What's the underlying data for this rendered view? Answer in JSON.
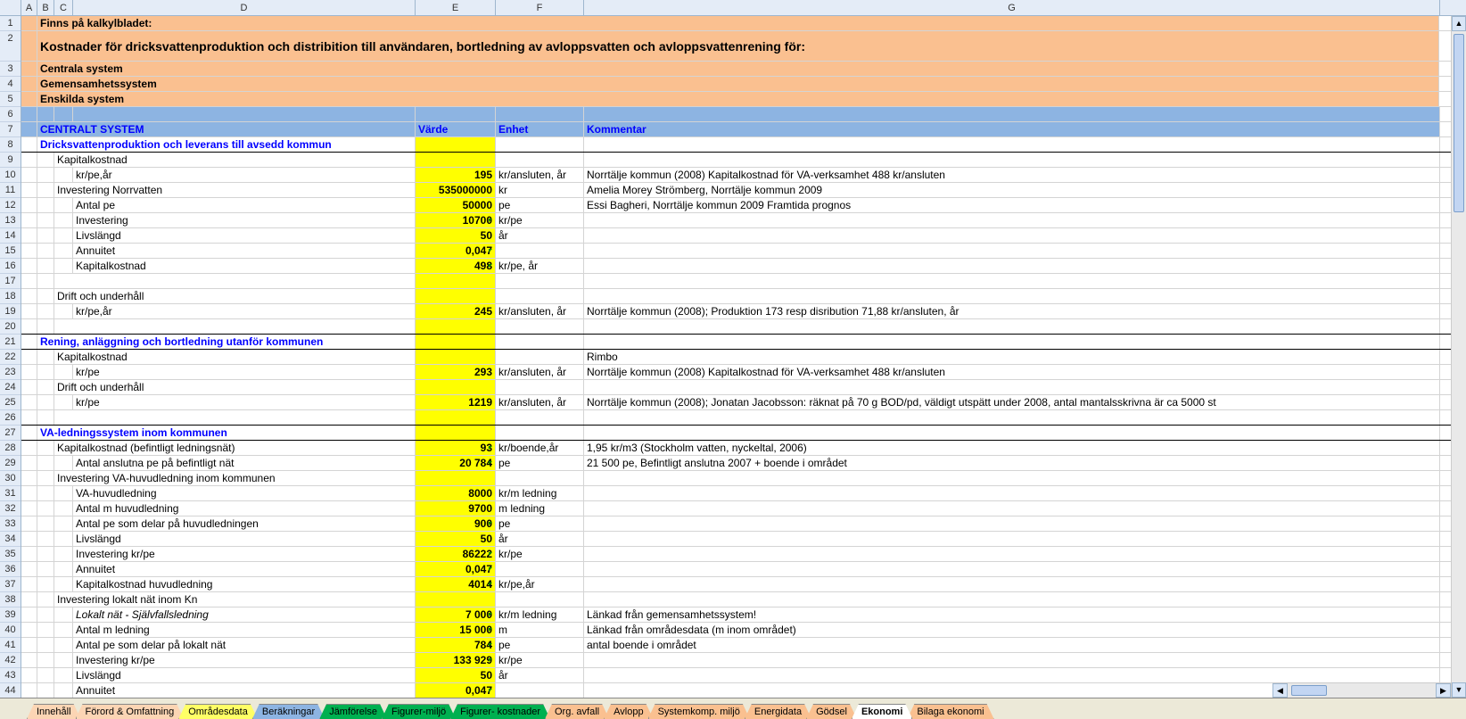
{
  "columns": [
    "A",
    "B",
    "C",
    "D",
    "E",
    "F",
    "G"
  ],
  "section_headers": {
    "varde": "Värde",
    "enhet": "Enhet",
    "kommentar": "Kommentar"
  },
  "orange": {
    "r1": "Finns på kalkylbladet:",
    "r2": "Kostnader för dricksvattenproduktion och distribition till användaren, bortledning av avloppsvatten och avloppsvattenrening för:",
    "r3": "Centrala system",
    "r4": "Gemensamhetssystem",
    "r5": "Enskilda system"
  },
  "central_title": "CENTRALT SYSTEM",
  "sec8": "Dricksvattenproduktion och leverans till avsedd kommun",
  "rows": [
    {
      "n": 9,
      "d": "Kapitalkostnad",
      "e": "",
      "f": "",
      "g": "",
      "ind": 2
    },
    {
      "n": 10,
      "d": "kr/pe,år",
      "e": "195",
      "f": "kr/ansluten, år",
      "g": "Norrtälje kommun (2008) Kapitalkostnad för VA-verksamhet 488 kr/ansluten",
      "ind": 3
    },
    {
      "n": 11,
      "d": "Investering Norrvatten",
      "e": "535000000",
      "f": "kr",
      "g": "Amelia Morey Strömberg, Norrtälje kommun 2009",
      "ind": 2
    },
    {
      "n": 12,
      "d": "Antal pe",
      "e": "50000",
      "f": "pe",
      "g": "Essi Bagheri, Norrtälje kommun 2009 Framtida prognos",
      "ind": 3
    },
    {
      "n": 13,
      "d": "Investering",
      "e": "10700",
      "f": "kr/pe",
      "g": "",
      "ind": 3,
      "tri": true
    },
    {
      "n": 14,
      "d": "Livslängd",
      "e": "50",
      "f": "år",
      "g": "",
      "ind": 3
    },
    {
      "n": 15,
      "d": "Annuitet",
      "e": "0,047",
      "f": "",
      "g": "",
      "ind": 3,
      "tri": true
    },
    {
      "n": 16,
      "d": "Kapitalkostnad",
      "e": "498",
      "f": "kr/pe, år",
      "g": "",
      "ind": 3,
      "tri": true
    },
    {
      "n": 17,
      "d": "",
      "e": "",
      "f": "",
      "g": "",
      "ind": 0
    },
    {
      "n": 18,
      "d": "Drift och underhåll",
      "e": "",
      "f": "",
      "g": "",
      "ind": 2
    },
    {
      "n": 19,
      "d": "kr/pe,år",
      "e": "245",
      "f": "kr/ansluten, år",
      "g": "Norrtälje kommun (2008); Produktion 173 resp disribution 71,88 kr/ansluten, år",
      "ind": 3
    },
    {
      "n": 20,
      "d": "",
      "e": "",
      "f": "",
      "g": "",
      "ind": 0,
      "bb": true
    }
  ],
  "sec21": "Rening, anläggning och bortledning utanför kommunen",
  "rows2": [
    {
      "n": 22,
      "d": "Kapitalkostnad",
      "e": "",
      "f": "",
      "g": "Rimbo",
      "ind": 2
    },
    {
      "n": 23,
      "d": "kr/pe",
      "e": "293",
      "f": "kr/ansluten, år",
      "g": "Norrtälje kommun (2008) Kapitalkostnad för VA-verksamhet 488 kr/ansluten",
      "ind": 3
    },
    {
      "n": 24,
      "d": "Drift och underhåll",
      "e": "",
      "f": "",
      "g": "",
      "ind": 2
    },
    {
      "n": 25,
      "d": "kr/pe",
      "e": "1219",
      "f": "kr/ansluten, år",
      "g": "Norrtälje kommun (2008); Jonatan Jacobsson: räknat på 70 g BOD/pd, väldigt utspätt under 2008, antal mantalsskrivna är ca 5000 st",
      "ind": 3
    },
    {
      "n": 26,
      "d": "",
      "e": "",
      "f": "",
      "g": "",
      "ind": 0,
      "bb": true
    }
  ],
  "sec27": "VA-ledningssystem inom kommunen",
  "rows3": [
    {
      "n": 28,
      "d": "Kapitalkostnad (befintligt ledningsnät)",
      "e": "93",
      "f": "kr/boende,år",
      "g": "1,95 kr/m3 (Stockholm vatten, nyckeltal, 2006)",
      "ind": 2,
      "tri": true
    },
    {
      "n": 29,
      "d": "Antal anslutna pe på befintligt nät",
      "e": "20 784",
      "f": "pe",
      "g": "21 500 pe, Befintligt anslutna 2007 + boende i området",
      "ind": 3,
      "tri": true
    },
    {
      "n": 30,
      "d": "Investering VA-huvudledning inom kommunen",
      "e": "",
      "f": "",
      "g": "",
      "ind": 2
    },
    {
      "n": 31,
      "d": "VA-huvudledning",
      "e": "8000",
      "f": "kr/m ledning",
      "g": "",
      "ind": 3
    },
    {
      "n": 32,
      "d": "Antal m huvudledning",
      "e": "9700",
      "f": "m ledning",
      "g": "",
      "ind": 3
    },
    {
      "n": 33,
      "d": "Antal pe som delar på huvudledningen",
      "e": "900",
      "f": "pe",
      "g": "",
      "ind": 3,
      "tri": true
    },
    {
      "n": 34,
      "d": "Livslängd",
      "e": "50",
      "f": "år",
      "g": "",
      "ind": 3
    },
    {
      "n": 35,
      "d": "Investering kr/pe",
      "e": "86222",
      "f": "kr/pe",
      "g": "",
      "ind": 3,
      "tri": true
    },
    {
      "n": 36,
      "d": "Annuitet",
      "e": "0,047",
      "f": "",
      "g": "",
      "ind": 3,
      "tri": true
    },
    {
      "n": 37,
      "d": "Kapitalkostnad huvudledning",
      "e": "4014",
      "f": "kr/pe,år",
      "g": "",
      "ind": 3,
      "tri": true
    },
    {
      "n": 38,
      "d": "Investering lokalt nät inom Kn",
      "e": "",
      "f": "",
      "g": "",
      "ind": 2
    },
    {
      "n": 39,
      "d": "Lokalt nät - Självfallsledning",
      "e": "7 000",
      "f": "kr/m ledning",
      "g": "Länkad från gemensamhetssystem!",
      "ind": 3,
      "italic": true,
      "tri": true
    },
    {
      "n": 40,
      "d": "Antal m ledning",
      "e": "15 000",
      "f": "m",
      "g": "Länkad från områdesdata (m inom området)",
      "ind": 3,
      "tri": true
    },
    {
      "n": 41,
      "d": "Antal pe som delar på lokalt nät",
      "e": "784",
      "f": "pe",
      "g": "antal boende i området",
      "ind": 3,
      "tri": true
    },
    {
      "n": 42,
      "d": "Investering kr/pe",
      "e": "133 929",
      "f": "kr/pe",
      "g": "",
      "ind": 3,
      "tri": true
    },
    {
      "n": 43,
      "d": "Livslängd",
      "e": "50",
      "f": "år",
      "g": "",
      "ind": 3
    },
    {
      "n": 44,
      "d": "Annuitet",
      "e": "0,047",
      "f": "",
      "g": "",
      "ind": 3,
      "tri": true
    }
  ],
  "tabs": [
    {
      "label": "Innehåll",
      "color": "#fcd5b4"
    },
    {
      "label": "Förord & Omfattning",
      "color": "#fcd5b4"
    },
    {
      "label": "Områdesdata",
      "color": "#ffff66"
    },
    {
      "label": "Beräkningar",
      "color": "#8db4e2"
    },
    {
      "label": "Jämförelse",
      "color": "#00b050"
    },
    {
      "label": "Figurer-miljö",
      "color": "#00b050"
    },
    {
      "label": "Figurer- kostnader",
      "color": "#00b050"
    },
    {
      "label": "Org. avfall",
      "color": "#fac090"
    },
    {
      "label": "Avlopp",
      "color": "#fac090"
    },
    {
      "label": "Systemkomp. miljö",
      "color": "#fac090"
    },
    {
      "label": "Energidata",
      "color": "#fac090"
    },
    {
      "label": "Gödsel",
      "color": "#fac090"
    },
    {
      "label": "Ekonomi",
      "color": "#ffffff",
      "active": true
    },
    {
      "label": "Bilaga ekonomi",
      "color": "#fac090"
    }
  ]
}
